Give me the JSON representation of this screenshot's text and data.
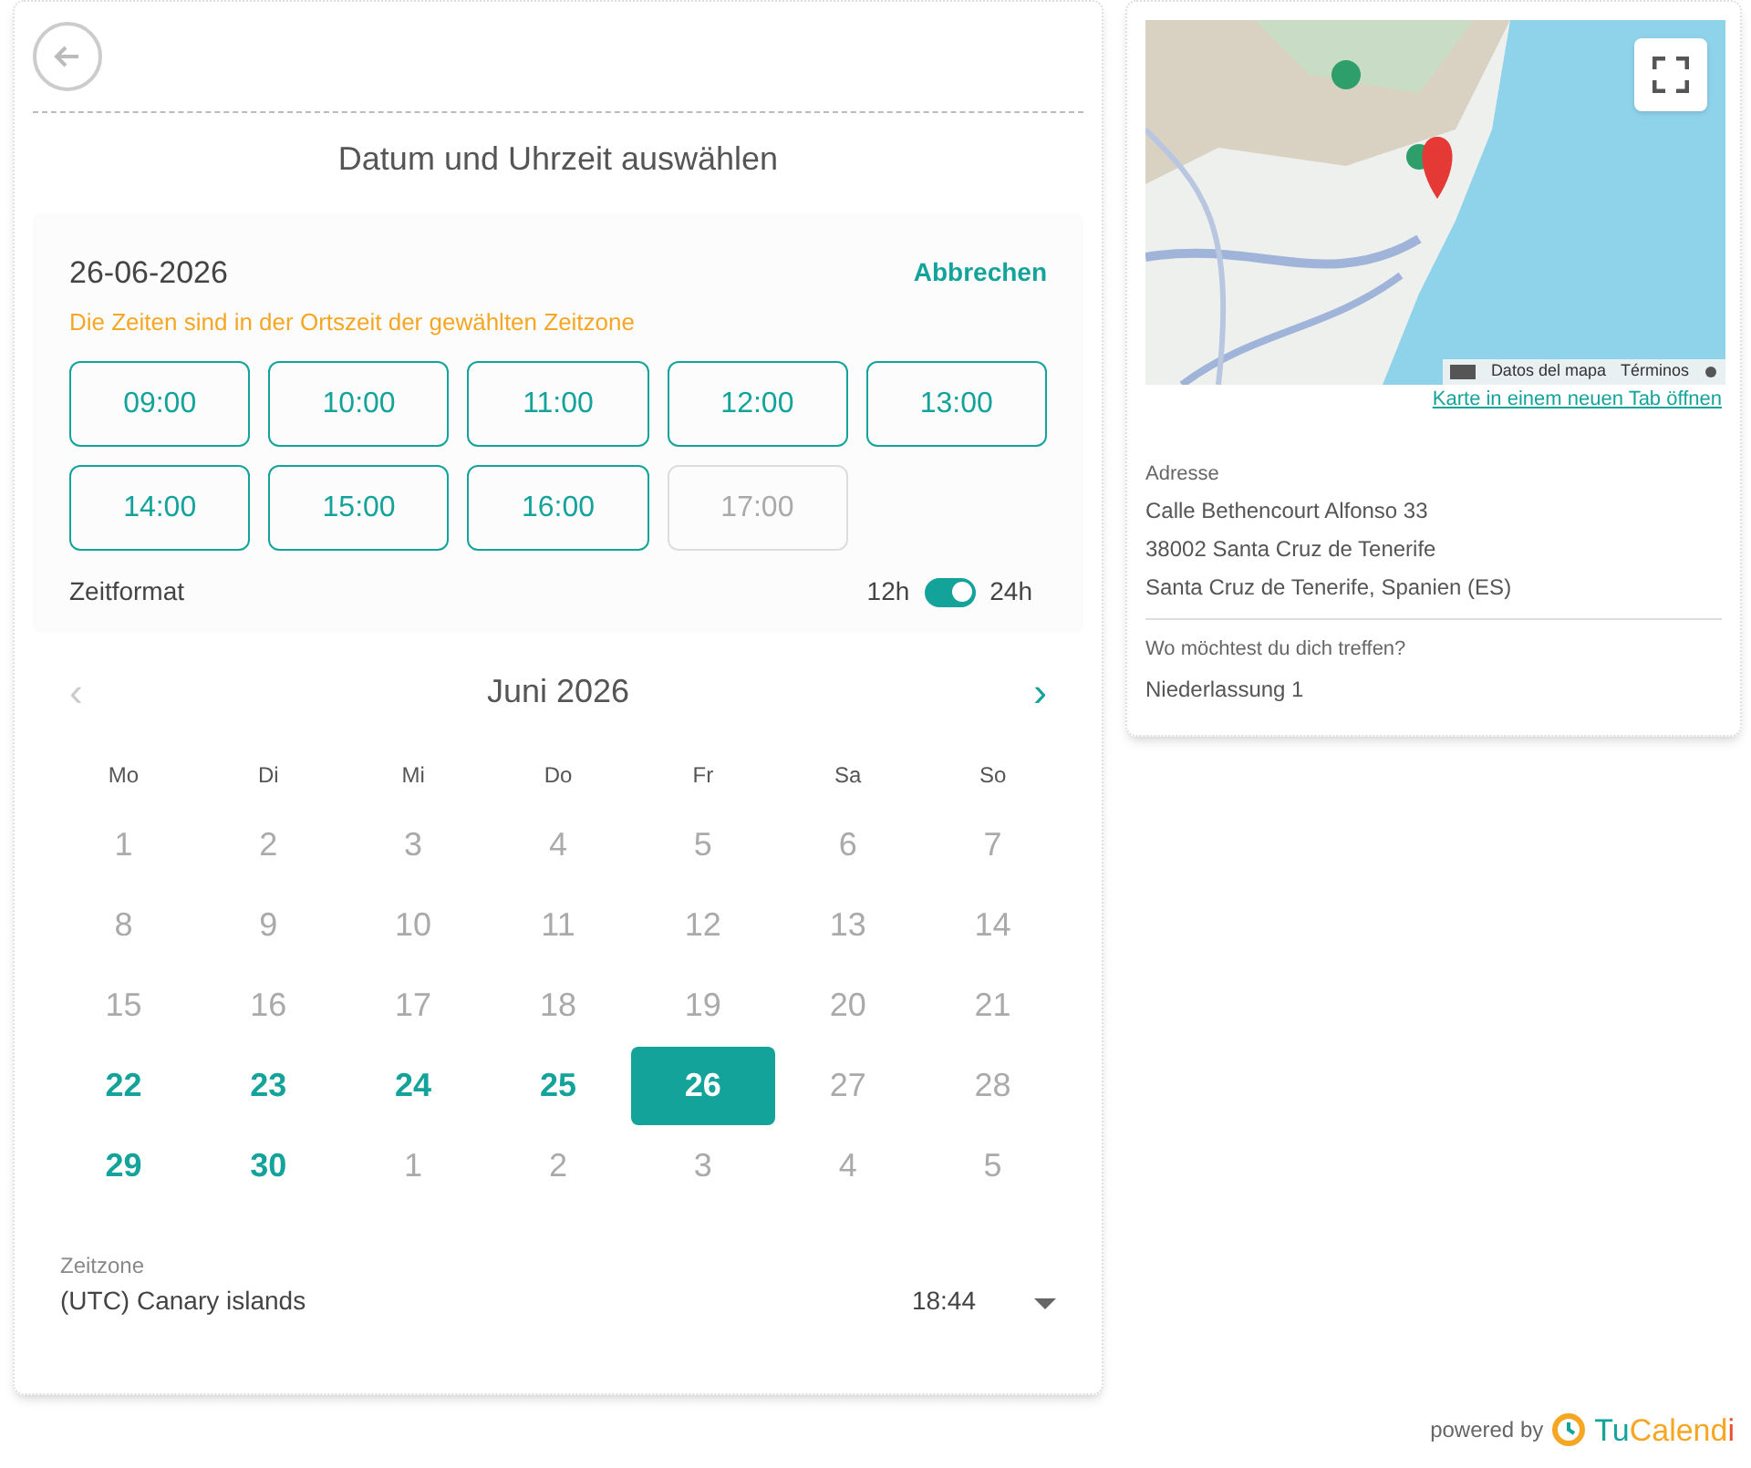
{
  "header": {
    "title": "Datum und Uhrzeit auswählen"
  },
  "slots": {
    "date": "26-06-2026",
    "cancel": "Abbrechen",
    "notice": "Die Zeiten sind in der Ortszeit der gewählten Zeitzone",
    "times": [
      {
        "label": "09:00",
        "disabled": false
      },
      {
        "label": "10:00",
        "disabled": false
      },
      {
        "label": "11:00",
        "disabled": false
      },
      {
        "label": "12:00",
        "disabled": false
      },
      {
        "label": "13:00",
        "disabled": false
      },
      {
        "label": "14:00",
        "disabled": false
      },
      {
        "label": "15:00",
        "disabled": false
      },
      {
        "label": "16:00",
        "disabled": false
      },
      {
        "label": "17:00",
        "disabled": true
      }
    ],
    "format": {
      "label": "Zeitformat",
      "left": "12h",
      "right": "24h",
      "on": true
    }
  },
  "calendar": {
    "month": "Juni 2026",
    "prev": "‹",
    "next": "›",
    "prev_disabled": true,
    "weekdays": [
      "Mo",
      "Di",
      "Mi",
      "Do",
      "Fr",
      "Sa",
      "So"
    ],
    "days": [
      {
        "label": "1",
        "available": false,
        "selected": false
      },
      {
        "label": "2",
        "available": false,
        "selected": false
      },
      {
        "label": "3",
        "available": false,
        "selected": false
      },
      {
        "label": "4",
        "available": false,
        "selected": false
      },
      {
        "label": "5",
        "available": false,
        "selected": false
      },
      {
        "label": "6",
        "available": false,
        "selected": false
      },
      {
        "label": "7",
        "available": false,
        "selected": false
      },
      {
        "label": "8",
        "available": false,
        "selected": false
      },
      {
        "label": "9",
        "available": false,
        "selected": false
      },
      {
        "label": "10",
        "available": false,
        "selected": false
      },
      {
        "label": "11",
        "available": false,
        "selected": false
      },
      {
        "label": "12",
        "available": false,
        "selected": false
      },
      {
        "label": "13",
        "available": false,
        "selected": false
      },
      {
        "label": "14",
        "available": false,
        "selected": false
      },
      {
        "label": "15",
        "available": false,
        "selected": false
      },
      {
        "label": "16",
        "available": false,
        "selected": false
      },
      {
        "label": "17",
        "available": false,
        "selected": false
      },
      {
        "label": "18",
        "available": false,
        "selected": false
      },
      {
        "label": "19",
        "available": false,
        "selected": false
      },
      {
        "label": "20",
        "available": false,
        "selected": false
      },
      {
        "label": "21",
        "available": false,
        "selected": false
      },
      {
        "label": "22",
        "available": true,
        "selected": false
      },
      {
        "label": "23",
        "available": true,
        "selected": false
      },
      {
        "label": "24",
        "available": true,
        "selected": false
      },
      {
        "label": "25",
        "available": true,
        "selected": false
      },
      {
        "label": "26",
        "available": true,
        "selected": true
      },
      {
        "label": "27",
        "available": false,
        "selected": false
      },
      {
        "label": "28",
        "available": false,
        "selected": false
      },
      {
        "label": "29",
        "available": true,
        "selected": false
      },
      {
        "label": "30",
        "available": true,
        "selected": false
      },
      {
        "label": "1",
        "available": false,
        "selected": false
      },
      {
        "label": "2",
        "available": false,
        "selected": false
      },
      {
        "label": "3",
        "available": false,
        "selected": false
      },
      {
        "label": "4",
        "available": false,
        "selected": false
      },
      {
        "label": "5",
        "available": false,
        "selected": false
      }
    ]
  },
  "timezone": {
    "label": "Zeitzone",
    "value": "(UTC) Canary islands",
    "time": "18:44"
  },
  "location": {
    "map": {
      "kind": "picture",
      "attribution": [
        "Datos del mapa",
        "Términos"
      ]
    },
    "open_link": "Karte in einem neuen Tab öffnen",
    "address_label": "Adresse",
    "address_lines": [
      "Calle Bethencourt Alfonso 33",
      "38002 Santa Cruz de Tenerife",
      "Santa Cruz de Tenerife, Spanien (ES)"
    ],
    "meet_label": "Wo möchtest du dich treffen?",
    "meet_value": "Niederlassung 1"
  },
  "footer": {
    "powered": "powered by",
    "logo": [
      {
        "text": "Tu",
        "color": "#14a39a"
      },
      {
        "text": "Calend",
        "color": "#f5a623"
      },
      {
        "text": "i",
        "color": "#e8502e"
      }
    ]
  }
}
